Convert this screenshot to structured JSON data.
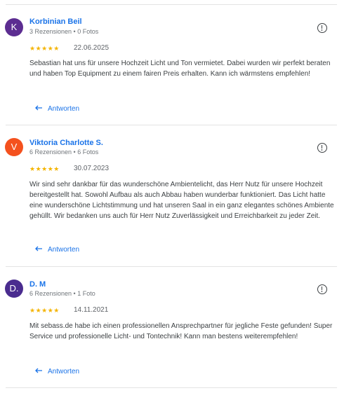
{
  "reviews": [
    {
      "initial": "K",
      "avatar_color": "#5c2d91",
      "name": "Korbinian Beil",
      "meta": "3 Rezensionen • 0 Fotos",
      "stars": "★★★★★",
      "rating": 5,
      "date": "22.06.2025",
      "text": "Sebastian hat uns für unsere Hochzeit Licht und Ton vermietet. Dabei wurden wir perfekt beraten und haben Top Equipment zu einem fairen Preis erhalten. Kann ich wärmstens empfehlen!",
      "reply_label": "Antworten"
    },
    {
      "initial": "V",
      "avatar_color": "#f4511e",
      "name": "Viktoria Charlotte S.",
      "meta": "6 Rezensionen • 6 Fotos",
      "stars": "★★★★★",
      "rating": 5,
      "date": "30.07.2023",
      "text": "Wir sind sehr dankbar für das wunderschöne Ambientelicht, das Herr Nutz für unsere Hochzeit bereitgestellt hat. Sowohl Aufbau als auch Abbau haben wunderbar funktioniert. Das Licht hatte eine wunderschöne Lichtstimmung und hat unseren Saal in ein ganz elegantes schönes Ambiente gehüllt. Wir bedanken uns auch für Herr Nutz Zuverlässigkeit und Erreichbarkeit zu jeder Zeit.",
      "reply_label": "Antworten"
    },
    {
      "initial": "D.",
      "avatar_color": "#4a2c8f",
      "name": "D. M",
      "meta": "6 Rezensionen • 1 Foto",
      "stars": "★★★★★",
      "rating": 5,
      "date": "14.11.2021",
      "text": "Mit sebass.de habe ich einen professionellen Ansprechpartner für jegliche Feste gefunden! Super Service und professionelle Licht- und Tontechnik! Kann man bestens weiterempfehlen!",
      "reply_label": "Antworten"
    }
  ]
}
